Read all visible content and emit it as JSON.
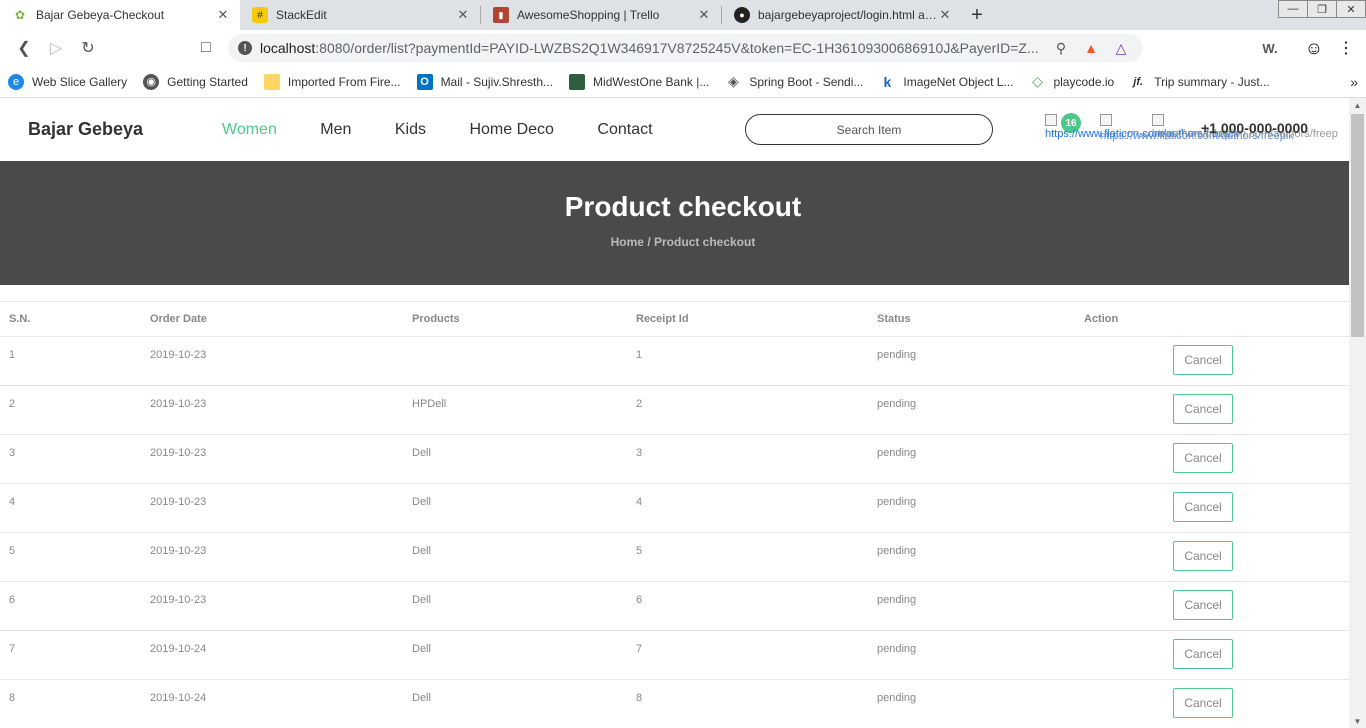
{
  "browser": {
    "tabs": [
      {
        "title": "Bajar Gebeya-Checkout",
        "icon": "leaf-icon",
        "active": true
      },
      {
        "title": "StackEdit",
        "icon": "stackedit-icon",
        "active": false
      },
      {
        "title": "AwesomeShopping | Trello",
        "icon": "trello-icon",
        "active": false
      },
      {
        "title": "bajargebeyaproject/login.html at d",
        "icon": "github-icon",
        "active": false
      }
    ],
    "url_host": "localhost",
    "url_rest": ":8080/order/list?paymentId=PAYID-LWZBS2Q1W346917V8725245V&token=EC-1H36109300686910J&PayerID=Z...",
    "bookmarks": [
      {
        "label": "Web Slice Gallery",
        "icon": "globe-icon"
      },
      {
        "label": "Getting Started",
        "icon": "firefox-icon"
      },
      {
        "label": "Imported From Fire...",
        "icon": "folder-icon"
      },
      {
        "label": "Mail - Sujiv.Shresth...",
        "icon": "outlook-icon"
      },
      {
        "label": "MidWestOne Bank |...",
        "icon": "bank-icon"
      },
      {
        "label": "Spring Boot - Sendi...",
        "icon": "diamond-icon"
      },
      {
        "label": "ImageNet Object L...",
        "icon": "k-icon"
      },
      {
        "label": "playcode.io",
        "icon": "playcode-icon"
      },
      {
        "label": "Trip summary - Just...",
        "icon": "jf-icon"
      }
    ]
  },
  "site": {
    "brand": "Bajar Gebeya",
    "nav": [
      "Women",
      "Men",
      "Kids",
      "Home Deco",
      "Contact"
    ],
    "search_placeholder": "Search Item",
    "cart_count": "16",
    "img_alt_1": "https://www.flaticon.com/authors/freepik",
    "img_alt_2": "https://www.flaticon.com/authors/freepik",
    "img_alt_3": "https://www.flaticon.com/authors/freep",
    "phone": "+1 000-000-0000"
  },
  "hero": {
    "title": "Product checkout",
    "breadcrumb": "Home / Product checkout"
  },
  "table": {
    "headers": [
      "S.N.",
      "Order Date",
      "Products",
      "Receipt Id",
      "Status",
      "Action"
    ],
    "cancel_label": "Cancel",
    "rows": [
      {
        "sn": "1",
        "date": "2019-10-23",
        "products": "",
        "receipt": "1",
        "status": "pending"
      },
      {
        "sn": "2",
        "date": "2019-10-23",
        "products": "HPDell",
        "receipt": "2",
        "status": "pending"
      },
      {
        "sn": "3",
        "date": "2019-10-23",
        "products": "Dell",
        "receipt": "3",
        "status": "pending"
      },
      {
        "sn": "4",
        "date": "2019-10-23",
        "products": "Dell",
        "receipt": "4",
        "status": "pending"
      },
      {
        "sn": "5",
        "date": "2019-10-23",
        "products": "Dell",
        "receipt": "5",
        "status": "pending"
      },
      {
        "sn": "6",
        "date": "2019-10-23",
        "products": "Dell",
        "receipt": "6",
        "status": "pending"
      },
      {
        "sn": "7",
        "date": "2019-10-24",
        "products": "Dell",
        "receipt": "7",
        "status": "pending"
      },
      {
        "sn": "8",
        "date": "2019-10-24",
        "products": "Dell",
        "receipt": "8",
        "status": "pending"
      }
    ]
  },
  "colors": {
    "accent": "#4fc88c",
    "hero_bg": "#4a4a4a"
  }
}
